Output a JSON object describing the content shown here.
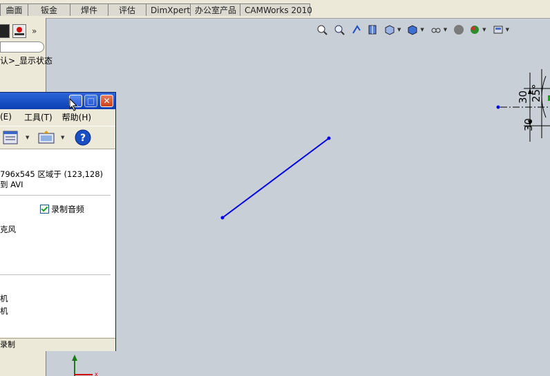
{
  "tabs": [
    "曲面",
    "钣金",
    "焊件",
    "评估",
    "DimXpert",
    "办公室产品",
    "CAMWorks 2010"
  ],
  "left_panel": {
    "more": "»",
    "tree_text": "认>_显示状态"
  },
  "dialog": {
    "menu": [
      "(E)",
      "工具(T)",
      "帮助(H)"
    ],
    "info_line1": "796x545 区域于 (123,128)",
    "info_line2": "到 AVI",
    "record_audio_label": "录制音频",
    "record_audio_checked": true,
    "mic_label": "克风",
    "device1": "机",
    "device2": "机",
    "status": "录制",
    "help_glyph": "?",
    "minimize": "_",
    "maximize": "□",
    "close": "✕"
  },
  "sketch": {
    "dim_30_top": "30",
    "dim_25": "25°",
    "dim_30_bottom": "30"
  },
  "hud_icons": [
    "zoom-to-fit-icon",
    "zoom-to-area-icon",
    "previous-view-icon",
    "section-view-icon",
    "view-orientation-icon",
    "display-style-icon",
    "hide-show-items-icon",
    "edit-appearance-icon",
    "apply-scene-icon",
    "view-settings-icon"
  ],
  "colors": {
    "graphics_bg": "#c8cfd6",
    "sketch_line": "#0000e6",
    "titlebar": "#0a3fb3"
  }
}
